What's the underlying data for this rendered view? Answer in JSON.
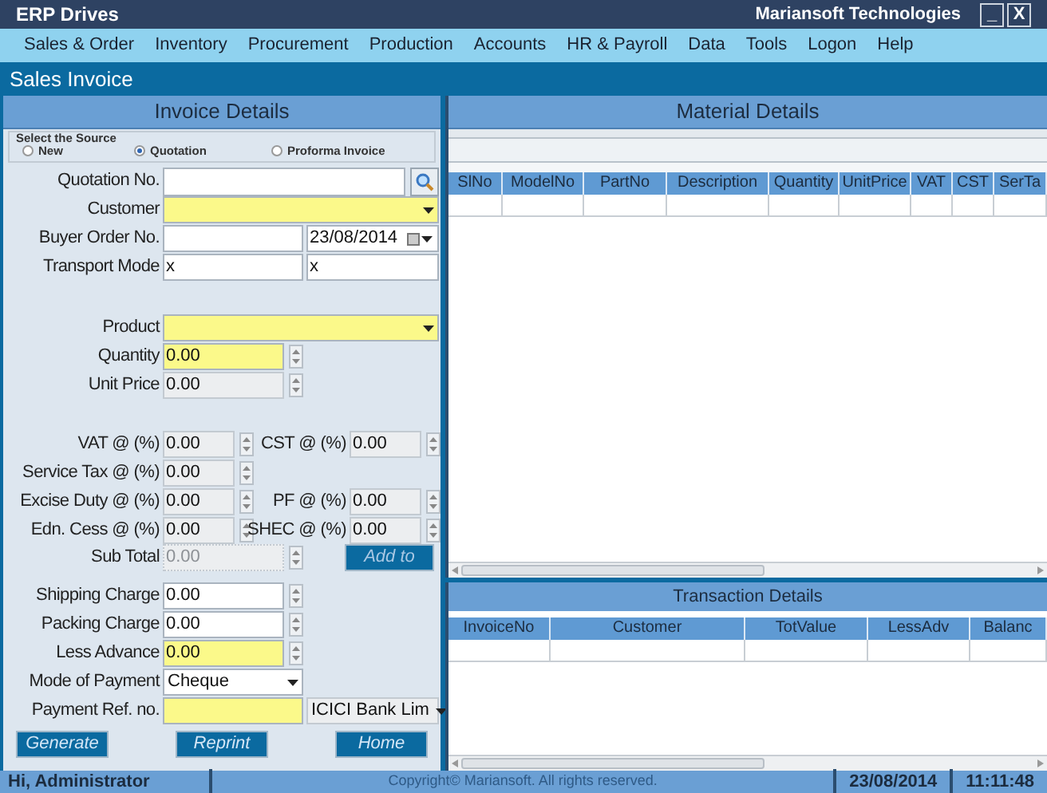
{
  "title_bar": {
    "title": "ERP Drives",
    "company": "Mariansoft Technologies",
    "buttons": [
      "_",
      "X"
    ]
  },
  "menu": {
    "items": [
      "Sales & Order",
      "Inventory",
      "Procurement",
      "Production",
      "Accounts",
      "HR & Payroll",
      "Data",
      "Tools",
      "Logon",
      "Help"
    ]
  },
  "page_title": "Sales Invoice",
  "invoice_details": {
    "title": "Invoice Details",
    "source": {
      "label": "Select the Source",
      "options": [
        {
          "label": "New",
          "selected": false
        },
        {
          "label": "Quotation",
          "selected": true
        },
        {
          "label": "Proforma Invoice",
          "selected": false
        }
      ]
    },
    "groups": [
      {
        "kind": "rows",
        "rows": [
          [
            {
              "kind": "search",
              "label": "Quotation No.",
              "required": false,
              "readonly": false,
              "disabled": false
            }
          ],
          [
            {
              "kind": "combo",
              "label": "Customer",
              "required": true,
              "readonly": false,
              "disabled": false
            }
          ],
          [
            {
              "kind": "text",
              "label": "Buyer Order No.",
              "required": false,
              "readonly": false,
              "disabled": false
            },
            {
              "kind": "date",
              "value": "23/08/2014",
              "required": false,
              "readonly": false,
              "disabled": false
            }
          ],
          [
            {
              "kind": "text",
              "label": "Transport Mode",
              "value": "x",
              "required": false,
              "readonly": false,
              "disabled": false
            },
            {
              "kind": "text",
              "value": "x",
              "required": false,
              "readonly": false,
              "disabled": false
            }
          ]
        ]
      },
      {
        "kind": "rows",
        "rows": [
          [
            {
              "kind": "combo",
              "label": "Product",
              "required": true,
              "readonly": false,
              "disabled": false
            }
          ],
          [
            {
              "kind": "spin",
              "label": "Quantity",
              "value": "0.00",
              "required": true,
              "readonly": false,
              "disabled": false
            }
          ],
          [
            {
              "kind": "spin",
              "label": "Unit Price",
              "value": "0.00",
              "required": false,
              "readonly": true,
              "disabled": false
            }
          ]
        ]
      },
      {
        "kind": "grid",
        "rows": [
          [
            {
              "kind": "spin",
              "label": "VAT @ (%)",
              "value": "0.00",
              "required": false,
              "readonly": true,
              "disabled": false
            },
            {
              "kind": "spin",
              "label": "CST @ (%)",
              "value": "0.00",
              "required": false,
              "readonly": true,
              "disabled": false
            }
          ],
          [
            {
              "kind": "spin",
              "label": "Service Tax @ (%)",
              "value": "0.00",
              "required": false,
              "readonly": true,
              "disabled": false
            }
          ],
          [
            {
              "kind": "spin",
              "label": "Excise Duty @ (%)",
              "value": "0.00",
              "required": false,
              "readonly": true,
              "disabled": false
            },
            {
              "kind": "spin",
              "label": "PF @ (%)",
              "value": "0.00",
              "required": false,
              "readonly": true,
              "disabled": false
            }
          ],
          [
            {
              "kind": "spin",
              "label": "Edn. Cess @ (%)",
              "value": "0.00",
              "required": false,
              "readonly": true,
              "disabled": false
            },
            {
              "kind": "spin",
              "label": "SHEC @ (%)",
              "value": "0.00",
              "required": false,
              "readonly": true,
              "disabled": false
            }
          ]
        ]
      },
      {
        "kind": "rows",
        "rows": [
          [
            {
              "kind": "spin",
              "label": "Sub Total",
              "value": "0.00",
              "required": false,
              "readonly": true,
              "disabled": true
            },
            {
              "kind": "button",
              "label": "Add to"
            }
          ]
        ]
      },
      {
        "kind": "rows",
        "rows": [
          [
            {
              "kind": "spin",
              "label": "Shipping Charge",
              "value": "0.00",
              "required": false,
              "readonly": false,
              "disabled": false
            }
          ],
          [
            {
              "kind": "spin",
              "label": "Packing Charge",
              "value": "0.00",
              "required": false,
              "readonly": false,
              "disabled": false
            }
          ],
          [
            {
              "kind": "spin",
              "label": "Less Advance",
              "value": "0.00",
              "required": true,
              "readonly": false,
              "disabled": false
            }
          ],
          [
            {
              "kind": "select",
              "label": "Mode of Payment",
              "value": "Cheque",
              "required": false,
              "readonly": false,
              "disabled": false
            }
          ],
          [
            {
              "kind": "text",
              "label": "Payment Ref. no.",
              "required": true,
              "readonly": false,
              "disabled": false
            },
            {
              "kind": "select",
              "value": "ICICI Bank Lim",
              "required": false,
              "readonly": true,
              "disabled": false
            }
          ]
        ]
      }
    ],
    "buttons": [
      "Generate",
      "Reprint",
      "Home"
    ]
  },
  "material_details": {
    "title": "Material Details",
    "columns": [
      "SlNo",
      "ModelNo",
      "PartNo",
      "Description",
      "Quantity",
      "UnitPrice",
      "VAT",
      "CST",
      "SerTa"
    ]
  },
  "transaction_details": {
    "title": "Transaction Details",
    "columns": [
      "InvoiceNo",
      "Customer",
      "TotValue",
      "LessAdv",
      "Balanc"
    ]
  },
  "status_bar": {
    "user": "Hi, Administrator",
    "copyright": "Copyright© Mariansoft. All rights reserved.",
    "date": "23/08/2014",
    "time": "11:11:48"
  }
}
